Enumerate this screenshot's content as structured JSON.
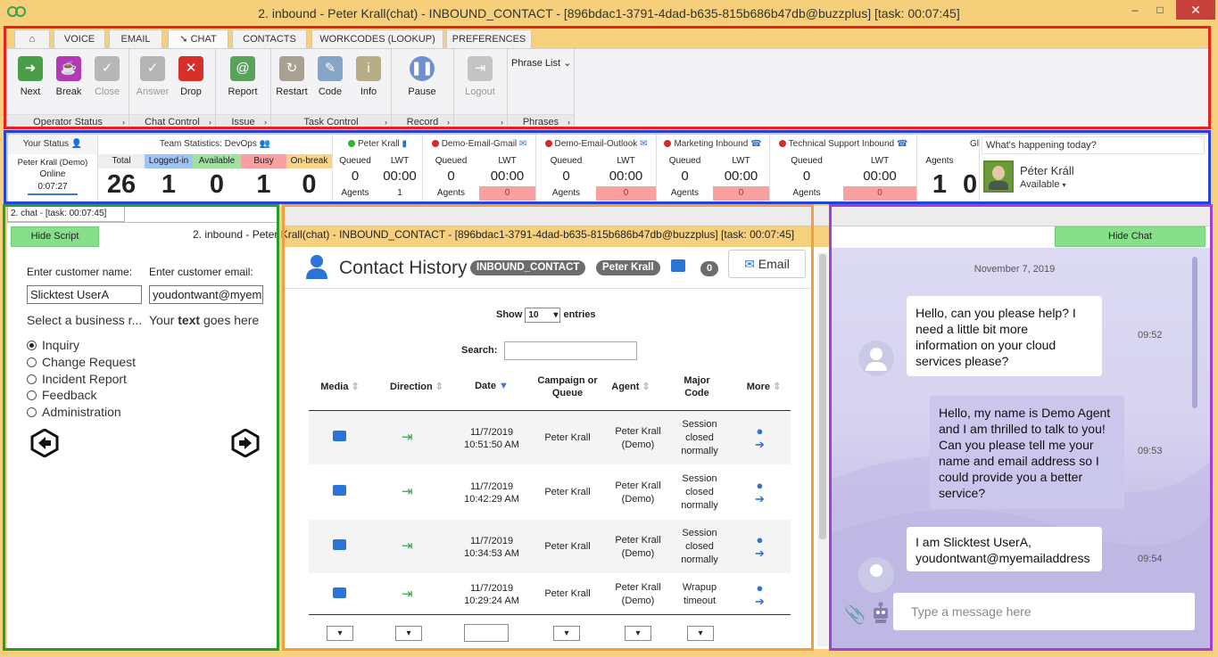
{
  "window": {
    "title": "2. inbound - Peter Krall(chat) - INBOUND_CONTACT - [896bdac1-3791-4dad-b635-815b686b47db@buzzplus] [task: 00:07:45]",
    "min_glyph": "–",
    "max_glyph": "□",
    "close_glyph": "✕"
  },
  "tabs": [
    "VOICE",
    "EMAIL",
    "CHAT",
    "CONTACTS",
    "WORKCODES (LOOKUP)",
    "PREFERENCES"
  ],
  "ribbon": {
    "groups": {
      "operator_status": "Operator Status",
      "chat_control": "Chat Control",
      "issue": "Issue",
      "task_control": "Task Control",
      "record": "Record",
      "phrases": "Phrases"
    },
    "buttons": {
      "next": "Next",
      "break": "Break",
      "close": "Close",
      "answer": "Answer",
      "drop": "Drop",
      "report": "Report",
      "restart": "Restart",
      "code": "Code",
      "info": "Info",
      "pause": "Pause",
      "logout": "Logout",
      "phrase_list": "Phrase List"
    },
    "chevron": "›"
  },
  "stats": {
    "your_status": {
      "header": "Your Status",
      "name": "Peter Krall (Demo)",
      "state": "Online",
      "timer": "0:07:27"
    },
    "team": {
      "header": "Team Statistics: DevOps",
      "labels": [
        "Total",
        "Logged-in",
        "Available",
        "Busy",
        "On-break"
      ],
      "values": [
        "26",
        "1",
        "0",
        "1",
        "0"
      ]
    },
    "queues": [
      {
        "name": "Peter Krall",
        "queued_label": "Queued",
        "queued": "0",
        "lwt_label": "LWT",
        "lwt": "00:00",
        "agents_label": "Agents",
        "agents": "1"
      },
      {
        "name": "Demo-Email-Gmail",
        "queued_label": "Queued",
        "queued": "0",
        "lwt_label": "LWT",
        "lwt": "00:00",
        "agents_label": "Agents",
        "agents": "0"
      },
      {
        "name": "Demo-Email-Outlook",
        "queued_label": "Queued",
        "queued": "0",
        "lwt_label": "LWT",
        "lwt": "00:00",
        "agents_label": "Agents",
        "agents": "0"
      },
      {
        "name": "Marketing Inbound",
        "queued_label": "Queued",
        "queued": "0",
        "lwt_label": "LWT",
        "lwt": "00:00",
        "agents_label": "Agents",
        "agents": "0"
      },
      {
        "name": "Technical Support Inbound",
        "queued_label": "Queued",
        "queued": "0",
        "lwt_label": "LWT",
        "lwt": "00:00",
        "agents_label": "Agents",
        "agents": "0"
      }
    ],
    "global": {
      "header": "Gl",
      "agents_label": "Agents",
      "agents": "1",
      "extra": "0"
    },
    "social": {
      "prompt": "What's happening today?",
      "name": "Péter Králl",
      "status": "Available"
    },
    "colors": {
      "logged_in": "#9fc5f8",
      "available": "#9fe39f",
      "busy": "#f9a0a0",
      "on_break": "#f8d38a"
    }
  },
  "left": {
    "tab_label": "2. chat - [task: 00:07:45]",
    "hide_script": "Hide Script",
    "name_label": "Enter customer name:",
    "email_label": "Enter customer email:",
    "name_value": "Slicktest UserA",
    "email_value": "youdontwant@myem",
    "business_label": "Select a business r...",
    "text_pre": "Your ",
    "text_bold": "text",
    "text_post": " goes here",
    "options": [
      "Inquiry",
      "Change Request",
      "Incident Report",
      "Feedback",
      "Administration"
    ]
  },
  "middle": {
    "header": "2. inbound - Peter Krall(chat) - INBOUND_CONTACT - [896bdac1-3791-4dad-b635-815b686b47db@buzzplus] [task: 00:07:45]",
    "title": "Contact History",
    "badge_contact": "INBOUND_CONTACT",
    "badge_agent": "Peter Krall",
    "count": "0",
    "email_button": "Email",
    "show_label": "Show",
    "show_value": "10",
    "entries_label": "entries",
    "search_label": "Search:",
    "columns": [
      "Media",
      "Direction",
      "Date",
      "Campaign or Queue",
      "Agent",
      "Major Code",
      "More"
    ],
    "rows": [
      {
        "date": "11/7/2019",
        "time": "10:51:50 AM",
        "queue": "Peter Krall",
        "agent": "Peter Krall (Demo)",
        "code": "Session closed normally"
      },
      {
        "date": "11/7/2019",
        "time": "10:42:29 AM",
        "queue": "Peter Krall",
        "agent": "Peter Krall (Demo)",
        "code": "Session closed normally"
      },
      {
        "date": "11/7/2019",
        "time": "10:34:53 AM",
        "queue": "Peter Krall",
        "agent": "Peter Krall (Demo)",
        "code": "Session closed normally"
      },
      {
        "date": "11/7/2019",
        "time": "10:29:24 AM",
        "queue": "Peter Krall",
        "agent": "Peter Krall (Demo)",
        "code": "Wrapup timeout"
      }
    ]
  },
  "chat": {
    "hide_chat": "Hide Chat",
    "date": "November 7, 2019",
    "messages": [
      {
        "from": "customer",
        "text": "Hello, can you please help? I need a little bit more information on your cloud services please?",
        "time": "09:52"
      },
      {
        "from": "agent",
        "text": "Hello, my name is Demo Agent and I am thrilled to talk to you! Can you please tell me your name and email address so I could provide you a better service?",
        "time": "09:53"
      },
      {
        "from": "customer",
        "text": "I am Slicktest UserA, youdontwant@myemailaddress",
        "time": "09:54"
      }
    ],
    "placeholder": "Type a message here"
  },
  "highlight_colors": {
    "ribbon": "#e5221b",
    "stats": "#2244dd",
    "script": "#22a02a",
    "history": "#f0a040",
    "chat": "#a23fd6"
  }
}
